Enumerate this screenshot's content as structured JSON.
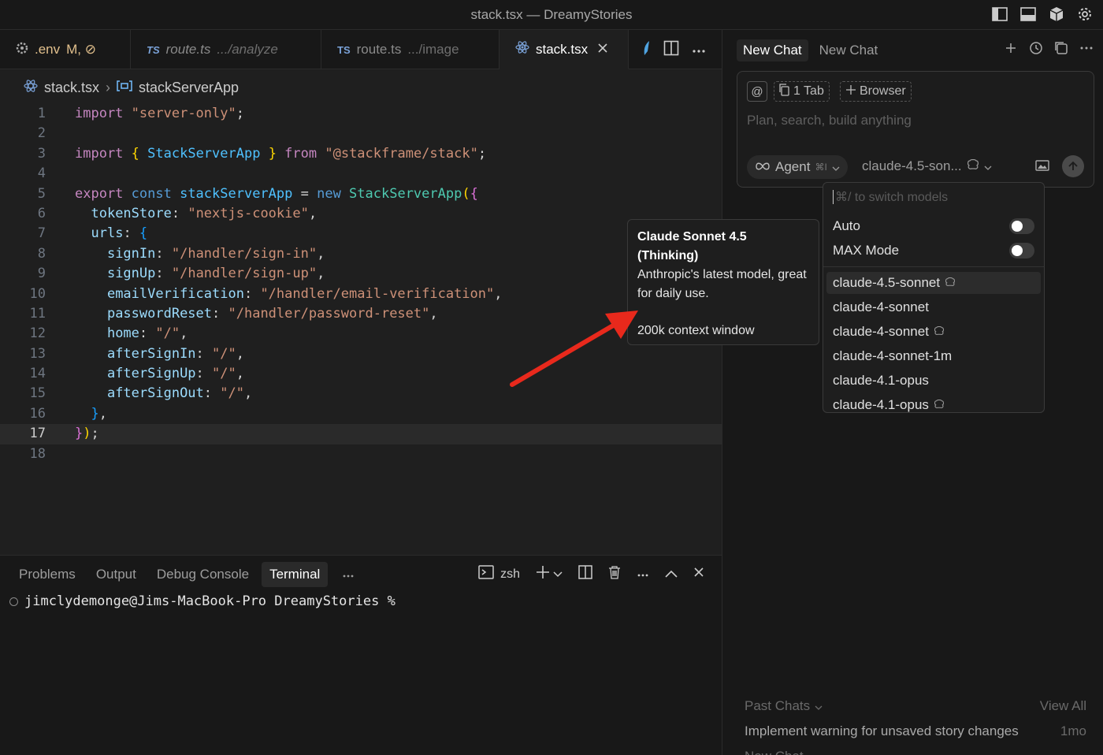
{
  "window": {
    "title": "stack.tsx — DreamyStories"
  },
  "tabs": [
    {
      "icon": "gear-icon",
      "label": ".env",
      "suffix": "M, ⊘"
    },
    {
      "badge": "TS",
      "label": "route.ts",
      "path": ".../analyze"
    },
    {
      "badge": "TS",
      "label": "route.ts",
      "path": ".../image"
    },
    {
      "icon": "react-icon",
      "label": "stack.tsx"
    }
  ],
  "breadcrumb": {
    "file": "stack.tsx",
    "symbol": "stackServerApp"
  },
  "code_lines": [
    "1",
    "2",
    "3",
    "4",
    "5",
    "6",
    "7",
    "8",
    "9",
    "10",
    "11",
    "12",
    "13",
    "14",
    "15",
    "16",
    "17",
    "18"
  ],
  "code": {
    "l1_kw": "import",
    "l1_str": "\"server-only\"",
    "l1_end": ";",
    "l3_kw": "import",
    "l3_ob": "{",
    "l3_id": " StackServerApp ",
    "l3_cb": "}",
    "l3_from": " from ",
    "l3_str": "\"@stackframe/stack\"",
    "l3_end": ";",
    "l5_export": "export",
    "l5_const": " const ",
    "l5_name": "stackServerApp",
    "l5_eq": " = ",
    "l5_new": "new ",
    "l5_cls": "StackServerApp",
    "l5_p": "(",
    "l5_b": "{",
    "l6_key": "tokenStore",
    "l6_str": "\"nextjs-cookie\"",
    "l7_key": "urls",
    "l7_b": "{",
    "l8_key": "signIn",
    "l8_str": "\"/handler/sign-in\"",
    "l9_key": "signUp",
    "l9_str": "\"/handler/sign-up\"",
    "l10_key": "emailVerification",
    "l10_str": "\"/handler/email-verification\"",
    "l11_key": "passwordReset",
    "l11_str": "\"/handler/password-reset\"",
    "l12_key": "home",
    "l12_str": "\"/\"",
    "l13_key": "afterSignIn",
    "l13_str": "\"/\"",
    "l14_key": "afterSignUp",
    "l14_str": "\"/\"",
    "l15_key": "afterSignOut",
    "l15_str": "\"/\"",
    "l16_b": "}",
    "l16_c": ",",
    "l17_b": "}",
    "l17_p": ")",
    "l17_e": ";"
  },
  "panel": {
    "tabs": [
      "Problems",
      "Output",
      "Debug Console",
      "Terminal"
    ],
    "active_tab": "Terminal",
    "shell": "zsh",
    "prompt": "jimclydemonge@Jims-MacBook-Pro DreamyStories %"
  },
  "chat": {
    "tabs": [
      "New Chat",
      "New Chat"
    ],
    "chips": {
      "tab_count": "1 Tab",
      "browser": "Browser"
    },
    "placeholder": "Plan, search, build anything",
    "agent_label": "Agent",
    "agent_shortcut": "⌘I",
    "model_selected": "claude-4.5-son...",
    "past_chats_label": "Past Chats",
    "view_all": "View All",
    "past_chats": [
      {
        "title": "Implement warning for unsaved story changes",
        "age": "1mo"
      }
    ],
    "past_more": "New Chat"
  },
  "model_dropdown": {
    "search_hint": "⌘/ to switch models",
    "auto_label": "Auto",
    "max_label": "MAX Mode",
    "models": [
      {
        "name": "claude-4.5-sonnet",
        "thinking": true,
        "selected": true
      },
      {
        "name": "claude-4-sonnet",
        "thinking": false
      },
      {
        "name": "claude-4-sonnet",
        "thinking": true
      },
      {
        "name": "claude-4-sonnet-1m",
        "thinking": false
      },
      {
        "name": "claude-4.1-opus",
        "thinking": false
      },
      {
        "name": "claude-4.1-opus",
        "thinking": true
      }
    ]
  },
  "tooltip": {
    "title": "Claude Sonnet 4.5 (Thinking)",
    "desc": "Anthropic's latest model, great for daily use.",
    "context": "200k context window"
  },
  "colors": {
    "accent_arrow": "#e8291c",
    "editor_bg": "#1f1f1f",
    "sidebar_bg": "#181818"
  }
}
